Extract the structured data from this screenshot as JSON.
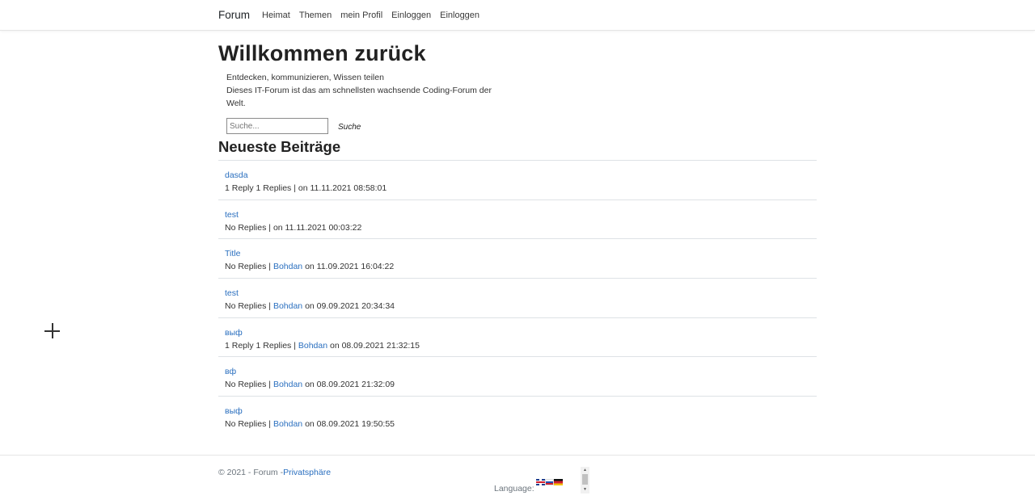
{
  "nav": {
    "brand": "Forum",
    "links": [
      "Heimat",
      "Themen",
      "mein Profil",
      "Einloggen",
      "Einloggen"
    ]
  },
  "hero": {
    "title": "Willkommen zurück",
    "intro_line1": "Entdecken, kommunizieren, Wissen teilen",
    "intro_line2": "Dieses IT-Forum ist das am schnellsten wachsende Coding-Forum der Welt."
  },
  "search": {
    "placeholder": "Suche...",
    "button": "Suche"
  },
  "posts_heading": "Neueste Beiträge",
  "posts": [
    {
      "title": "dasda",
      "replies": "1 Reply 1 Replies |",
      "author": "",
      "date": "on 11.11.2021 08:58:01"
    },
    {
      "title": "test",
      "replies": "No Replies |",
      "author": "",
      "date": "on 11.11.2021 00:03:22"
    },
    {
      "title": "Title",
      "replies": "No Replies |",
      "author": "Bohdan",
      "date": "on 11.09.2021 16:04:22"
    },
    {
      "title": "test",
      "replies": "No Replies |",
      "author": "Bohdan",
      "date": "on 09.09.2021 20:34:34"
    },
    {
      "title": "выф",
      "replies": "1 Reply 1 Replies |",
      "author": "Bohdan",
      "date": "on 08.09.2021 21:32:15"
    },
    {
      "title": "вф",
      "replies": "No Replies |",
      "author": "Bohdan",
      "date": "on 08.09.2021 21:32:09"
    },
    {
      "title": "выф",
      "replies": "No Replies |",
      "author": "Bohdan",
      "date": "on 08.09.2021 19:50:55"
    }
  ],
  "footer": {
    "copyright": "© 2021 - Forum -",
    "privacy_link": "Privatsphäre",
    "language_label": "Language:",
    "flags": [
      "flag-uk-icon",
      "flag-ru-icon",
      "flag-de-icon"
    ]
  }
}
